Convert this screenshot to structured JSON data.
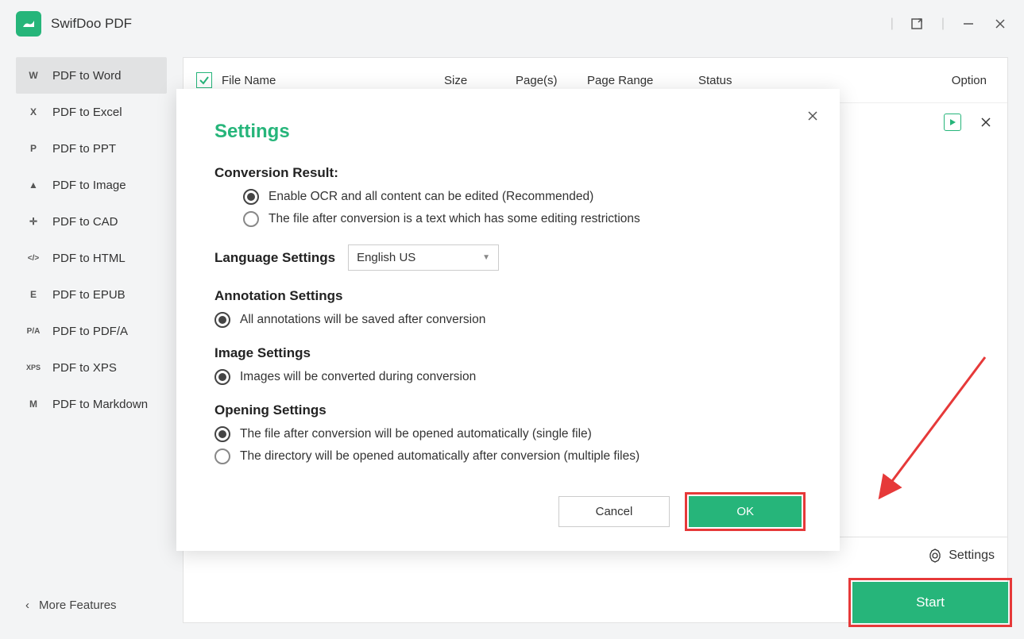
{
  "app": {
    "title": "SwifDoo PDF"
  },
  "sidebar": {
    "items": [
      {
        "icon": "W",
        "label": "PDF to Word"
      },
      {
        "icon": "X",
        "label": "PDF to Excel"
      },
      {
        "icon": "P",
        "label": "PDF to PPT"
      },
      {
        "icon": "▲",
        "label": "PDF to Image"
      },
      {
        "icon": "✛",
        "label": "PDF to CAD"
      },
      {
        "icon": "</>",
        "label": "PDF to HTML"
      },
      {
        "icon": "E",
        "label": "PDF to EPUB"
      },
      {
        "icon": "P/A",
        "label": "PDF to PDF/A"
      },
      {
        "icon": "XPS",
        "label": "PDF to XPS"
      },
      {
        "icon": "M",
        "label": "PDF to Markdown"
      }
    ],
    "more_label": "More Features"
  },
  "table": {
    "headers": {
      "file_name": "File Name",
      "size": "Size",
      "pages": "Page(s)",
      "page_range": "Page Range",
      "status": "Status",
      "option": "Option"
    }
  },
  "bottom": {
    "settings_label": "Settings",
    "start_label": "Start"
  },
  "modal": {
    "title": "Settings",
    "sections": {
      "conversion_result": {
        "heading": "Conversion Result:",
        "opt1": "Enable OCR and all content can be edited (Recommended)",
        "opt2": "The file after conversion is a text which has some editing restrictions"
      },
      "language": {
        "heading": "Language Settings",
        "value": "English US"
      },
      "annotation": {
        "heading": "Annotation Settings",
        "opt1": "All annotations will be saved after conversion"
      },
      "image": {
        "heading": "Image Settings",
        "opt1": "Images will be converted during conversion"
      },
      "opening": {
        "heading": "Opening Settings",
        "opt1": "The file after conversion will be opened automatically (single file)",
        "opt2": "The directory will be opened automatically after conversion (multiple files)"
      }
    },
    "buttons": {
      "cancel": "Cancel",
      "ok": "OK"
    }
  }
}
